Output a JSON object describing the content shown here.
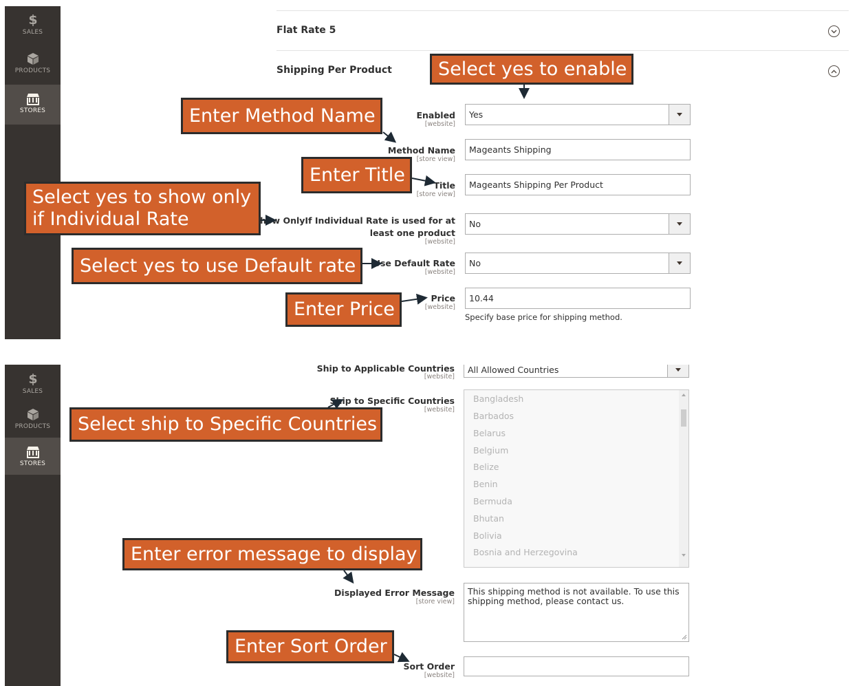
{
  "sidebar": {
    "items": [
      {
        "label": "SALES",
        "icon": "dollar-icon"
      },
      {
        "label": "PRODUCTS",
        "icon": "cube-icon"
      },
      {
        "label": "STORES",
        "icon": "store-icon"
      }
    ]
  },
  "panel1": {
    "section_flat_rate": "Flat Rate 5",
    "section_shipping_per_product": "Shipping Per Product",
    "fields": {
      "enabled": {
        "label": "Enabled",
        "scope": "[website]",
        "value": "Yes"
      },
      "method_name": {
        "label": "Method Name",
        "scope": "[store view]",
        "value": "Mageants Shipping"
      },
      "title": {
        "label": "Title",
        "scope": "[store view]",
        "value": "Mageants Shipping Per Product"
      },
      "show_only": {
        "label_line1": "Show OnlyIf Individual Rate is used for at",
        "label_line2": "least one product",
        "scope": "[website]",
        "value": "No"
      },
      "use_default_rate": {
        "label": "Use Default Rate",
        "scope": "[website]",
        "value": "No"
      },
      "price": {
        "label": "Price",
        "scope": "[website]",
        "value": "10.44",
        "note": "Specify base price for shipping method."
      }
    },
    "callouts": {
      "enable": "Select yes to enable",
      "method_name": "Enter Method Name",
      "title": "Enter Title",
      "show_only_line1": "Select yes to show only",
      "show_only_line2": "if Individual Rate",
      "default_rate": "Select yes to use Default rate",
      "price": "Enter Price"
    }
  },
  "panel2": {
    "fields": {
      "applicable_countries": {
        "label": "Ship to Applicable Countries",
        "scope": "[website]",
        "value": "All Allowed Countries"
      },
      "specific_countries": {
        "label": "Ship to Specific Countries",
        "scope": "[website]"
      },
      "error_message": {
        "label": "Displayed Error Message",
        "scope": "[store view]",
        "value": "This shipping method is not available. To use this shipping method, please contact us."
      },
      "sort_order": {
        "label": "Sort Order",
        "scope": "[website]",
        "value": ""
      }
    },
    "countries": [
      "Bangladesh",
      "Barbados",
      "Belarus",
      "Belgium",
      "Belize",
      "Benin",
      "Bermuda",
      "Bhutan",
      "Bolivia",
      "Bosnia and Herzegovina"
    ],
    "callouts": {
      "specific_countries": "Select ship to Specific Countries",
      "error_message": "Enter error message to display",
      "sort_order": "Enter Sort Order"
    }
  },
  "colors": {
    "callout_bg": "#d2612b",
    "callout_border": "#2c2c2c",
    "sidebar_bg": "#373330",
    "sidebar_active": "#524d49"
  }
}
